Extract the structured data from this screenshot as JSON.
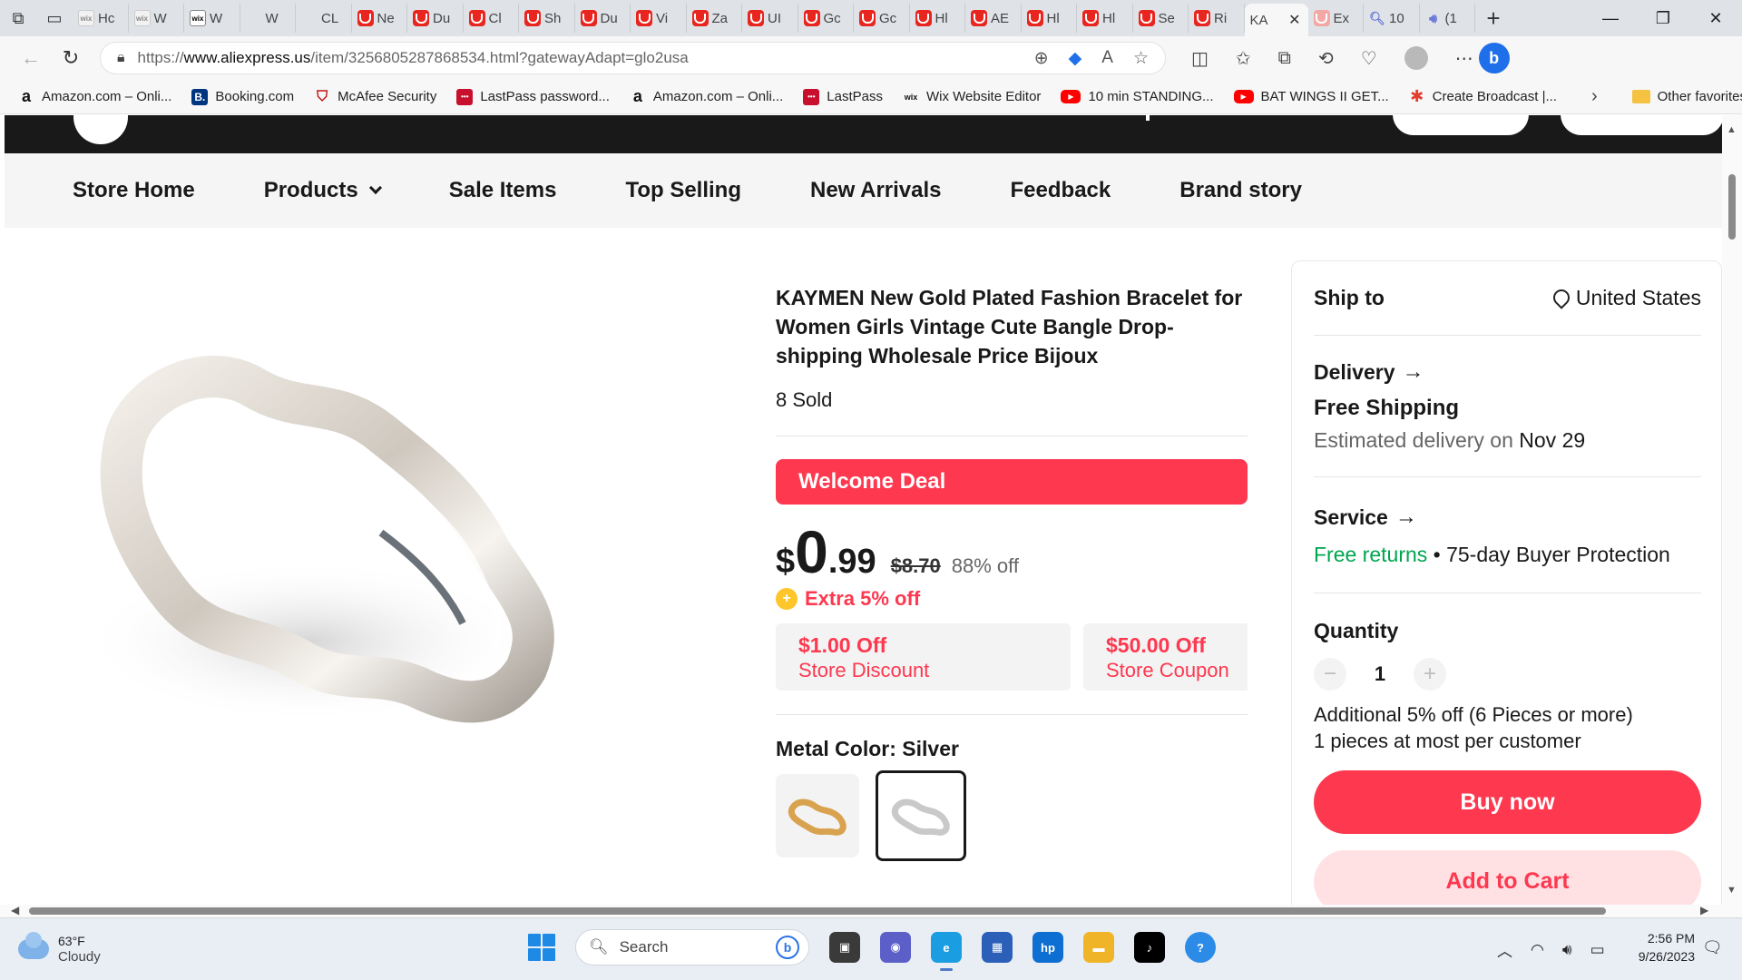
{
  "browser": {
    "tabs": [
      {
        "title": "Hc",
        "favicon": "wix-icon"
      },
      {
        "title": "W",
        "favicon": "wix-icon"
      },
      {
        "title": "W",
        "favicon": "wix-dark-icon"
      },
      {
        "title": "W",
        "favicon": "none"
      },
      {
        "title": "CL",
        "favicon": "none"
      },
      {
        "title": "Ne",
        "favicon": "mcafee-icon"
      },
      {
        "title": "Du",
        "favicon": "mcafee-icon"
      },
      {
        "title": "Cl",
        "favicon": "mcafee-icon"
      },
      {
        "title": "Sh",
        "favicon": "mcafee-icon"
      },
      {
        "title": "Du",
        "favicon": "mcafee-icon"
      },
      {
        "title": "Vi",
        "favicon": "mcafee-icon"
      },
      {
        "title": "Za",
        "favicon": "mcafee-icon"
      },
      {
        "title": "UI",
        "favicon": "mcafee-icon"
      },
      {
        "title": "Gc",
        "favicon": "mcafee-icon"
      },
      {
        "title": "Gc",
        "favicon": "mcafee-icon"
      },
      {
        "title": "Hl",
        "favicon": "mcafee-icon"
      },
      {
        "title": "AE",
        "favicon": "mcafee-icon"
      },
      {
        "title": "Hl",
        "favicon": "mcafee-icon"
      },
      {
        "title": "Hl",
        "favicon": "mcafee-icon"
      },
      {
        "title": "Se",
        "favicon": "mcafee-icon"
      },
      {
        "title": "Ri",
        "favicon": "mcafee-icon"
      }
    ],
    "active_tab": {
      "title": "KA",
      "close": "✕"
    },
    "after_tabs": [
      {
        "title": "Ex",
        "favicon": "mcafee-faded-icon"
      },
      {
        "title": "10",
        "favicon": "search-icon"
      },
      {
        "title": "(1",
        "favicon": "speaker-icon"
      }
    ],
    "new_tab": "+",
    "url_prefix": "https://",
    "url_host": "www.aliexpress.us",
    "url_path": "/item/3256805287868534.html?gatewayAdapt=glo2usa",
    "favorites": [
      {
        "label": "Amazon.com – Onli...",
        "icon": "a",
        "kind": "amazon"
      },
      {
        "label": "Booking.com",
        "icon": "B.",
        "kind": "booking"
      },
      {
        "label": "McAfee Security",
        "icon": "⛉",
        "kind": "mcafee"
      },
      {
        "label": "LastPass password...",
        "icon": "•••",
        "kind": "lastpass"
      },
      {
        "label": "Amazon.com – Onli...",
        "icon": "a",
        "kind": "amazon"
      },
      {
        "label": "LastPass",
        "icon": "•••",
        "kind": "lastpass"
      },
      {
        "label": "Wix Website Editor",
        "icon": "wix",
        "kind": "wix"
      },
      {
        "label": "10 min STANDING...",
        "icon": "▶",
        "kind": "youtube"
      },
      {
        "label": "BAT WINGS II GET...",
        "icon": "▶",
        "kind": "youtube"
      },
      {
        "label": "Create Broadcast |...",
        "icon": "✱",
        "kind": "star"
      }
    ],
    "other_favorites": "Other favorites"
  },
  "store_nav": {
    "items": [
      "Store Home",
      "Products",
      "Sale Items",
      "Top Selling",
      "New Arrivals",
      "Feedback",
      "Brand story"
    ]
  },
  "product": {
    "title": "KAYMEN New Gold Plated Fashion Bracelet for Women Girls Vintage Cute Bangle Drop-shipping Wholesale Price Bijoux",
    "sold": "8 Sold",
    "welcome_deal": "Welcome Deal",
    "price_currency": "$",
    "price_int": "0",
    "price_dec": ".99",
    "price_original": "$8.70",
    "price_off": "88% off",
    "extra_off": "Extra 5% off",
    "coupons": [
      {
        "amount": "$1.00 Off",
        "desc": "Store Discount"
      },
      {
        "amount": "$50.00 Off",
        "desc": "Store Coupon"
      }
    ],
    "metal_color_label": "Metal Color: Silver",
    "swatches": [
      {
        "name": "Gold",
        "color": "#d9a24e"
      },
      {
        "name": "Silver",
        "color": "#c9c9c9"
      }
    ],
    "selected_swatch": 1
  },
  "panel": {
    "ship_to_label": "Ship to",
    "ship_to_country": "United States",
    "delivery_label": "Delivery",
    "free_shipping": "Free Shipping",
    "estimated_prefix": "Estimated delivery on ",
    "estimated_date": "Nov 29",
    "service_label": "Service",
    "free_returns": "Free returns",
    "service_rest": " • 75-day Buyer Protection",
    "quantity_label": "Quantity",
    "quantity": "1",
    "qty_minus": "−",
    "qty_plus": "+",
    "note1": "Additional 5% off (6 Pieces or more)",
    "note2": "1 pieces at most per customer",
    "buy_now": "Buy now",
    "add_to_cart": "Add to Cart"
  },
  "colors": {
    "brand_red": "#fd384f",
    "green": "#00a64f",
    "dark": "#191919"
  },
  "taskbar": {
    "temp": "63°F",
    "condition": "Cloudy",
    "search_placeholder": "Search",
    "time": "2:56 PM",
    "date": "9/26/2023"
  }
}
